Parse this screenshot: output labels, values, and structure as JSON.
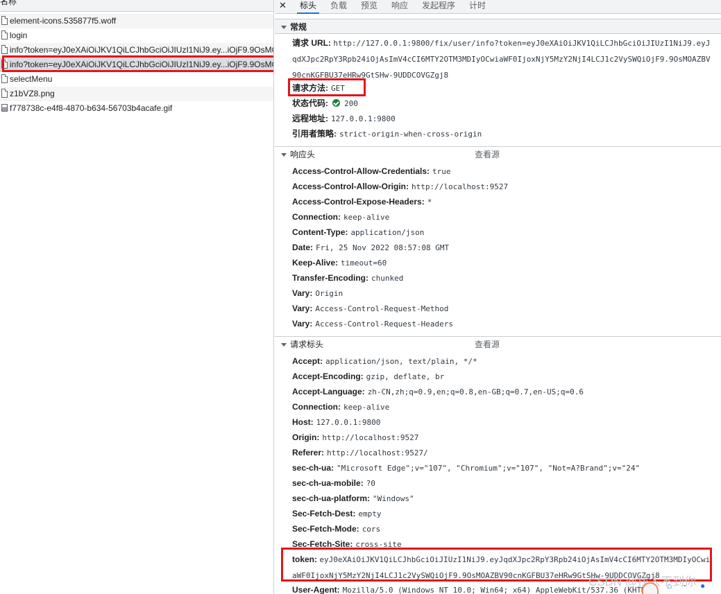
{
  "request_list": {
    "header": "名称",
    "items": [
      {
        "name": "element-icons.535877f5.woff",
        "type": "file"
      },
      {
        "name": "login",
        "type": "file"
      },
      {
        "name": "info?token=eyJ0eXAiOiJKV1QiLCJhbGciOiJIUzI1NiJ9.ey...iOjF9.9OsMO...",
        "type": "file"
      },
      {
        "name": "info?token=eyJ0eXAiOiJKV1QiLCJhbGciOiJIUzI1NiJ9.ey...iOjF9.9OsMO...",
        "type": "file",
        "selected": true
      },
      {
        "name": "selectMenu",
        "type": "file"
      },
      {
        "name": "z1bVZ8.png",
        "type": "file"
      },
      {
        "name": "f778738c-e4f8-4870-b634-56703b4acafe.gif",
        "type": "image"
      }
    ]
  },
  "tabs": {
    "close": "✕",
    "items": [
      "标头",
      "负载",
      "预览",
      "响应",
      "发起程序",
      "计时"
    ],
    "active": "标头"
  },
  "general": {
    "title": "常规",
    "request_url_label": "请求 URL:",
    "request_url": "http://127.0.0.1:9800/fix/user/info?token=eyJ0eXAiOiJKV1QiLCJhbGciOiJIUzI1NiJ9.eyJqdXJpc2RpY3Rpb24iOjAsImV4cCI6MTY2OTM3MDIyOCwiaWF0IjoxNjY5MzY2NjI4LCJ1c2VySWQiOjF9.9OsMOAZBV90cnKGFBU37eHRw9GtSHw-9UDDCOVGZgj8",
    "method_label": "请求方法:",
    "method": "GET",
    "status_label": "状态代码:",
    "status": "200",
    "remote_label": "远程地址:",
    "remote": "127.0.0.1:9800",
    "referrer_label": "引用者策略:",
    "referrer": "strict-origin-when-cross-origin"
  },
  "response_headers": {
    "title": "响应头",
    "view_source": "查看源",
    "items": [
      {
        "k": "Access-Control-Allow-Credentials:",
        "v": "true"
      },
      {
        "k": "Access-Control-Allow-Origin:",
        "v": "http://localhost:9527"
      },
      {
        "k": "Access-Control-Expose-Headers:",
        "v": "*"
      },
      {
        "k": "Connection:",
        "v": "keep-alive"
      },
      {
        "k": "Content-Type:",
        "v": "application/json"
      },
      {
        "k": "Date:",
        "v": "Fri, 25 Nov 2022 08:57:08 GMT"
      },
      {
        "k": "Keep-Alive:",
        "v": "timeout=60"
      },
      {
        "k": "Transfer-Encoding:",
        "v": "chunked"
      },
      {
        "k": "Vary:",
        "v": "Origin"
      },
      {
        "k": "Vary:",
        "v": "Access-Control-Request-Method"
      },
      {
        "k": "Vary:",
        "v": "Access-Control-Request-Headers"
      }
    ]
  },
  "request_headers": {
    "title": "请求标头",
    "view_source": "查看源",
    "items": [
      {
        "k": "Accept:",
        "v": "application/json, text/plain, */*"
      },
      {
        "k": "Accept-Encoding:",
        "v": "gzip, deflate, br"
      },
      {
        "k": "Accept-Language:",
        "v": "zh-CN,zh;q=0.9,en;q=0.8,en-GB;q=0.7,en-US;q=0.6"
      },
      {
        "k": "Connection:",
        "v": "keep-alive"
      },
      {
        "k": "Host:",
        "v": "127.0.0.1:9800"
      },
      {
        "k": "Origin:",
        "v": "http://localhost:9527"
      },
      {
        "k": "Referer:",
        "v": "http://localhost:9527/"
      },
      {
        "k": "sec-ch-ua:",
        "v": "\"Microsoft Edge\";v=\"107\", \"Chromium\";v=\"107\", \"Not=A?Brand\";v=\"24\""
      },
      {
        "k": "sec-ch-ua-mobile:",
        "v": "?0"
      },
      {
        "k": "sec-ch-ua-platform:",
        "v": "\"Windows\""
      },
      {
        "k": "Sec-Fetch-Dest:",
        "v": "empty"
      },
      {
        "k": "Sec-Fetch-Mode:",
        "v": "cors"
      },
      {
        "k": "Sec-Fetch-Site:",
        "v": "cross-site"
      }
    ],
    "token_label": "token:",
    "token": "eyJ0eXAiOiJKV1QiLCJhbGciOiJIUzI1NiJ9.eyJqdXJpc2RpY3Rpb24iOjAsImV4cCI6MTY2OTM3MDIyOCwiaWF0IjoxNjY5MzY2NjI4LCJ1c2VySWQiOjF9.9OsMOAZBV90cnKGFBU37eHRw9GtSHw-9UDDCOVGZgj8",
    "ua_label": "User-Agent:",
    "ua": "Mozilla/5.0 (Windows NT 10.0; Win64; x64) AppleWebKit/537.36 (KHTML"
  },
  "watermark": "CSDN @找人不到你",
  "colors": {
    "highlight": "#e3151a",
    "tab_active": "#1a73e8",
    "status_ok": "#188038"
  }
}
